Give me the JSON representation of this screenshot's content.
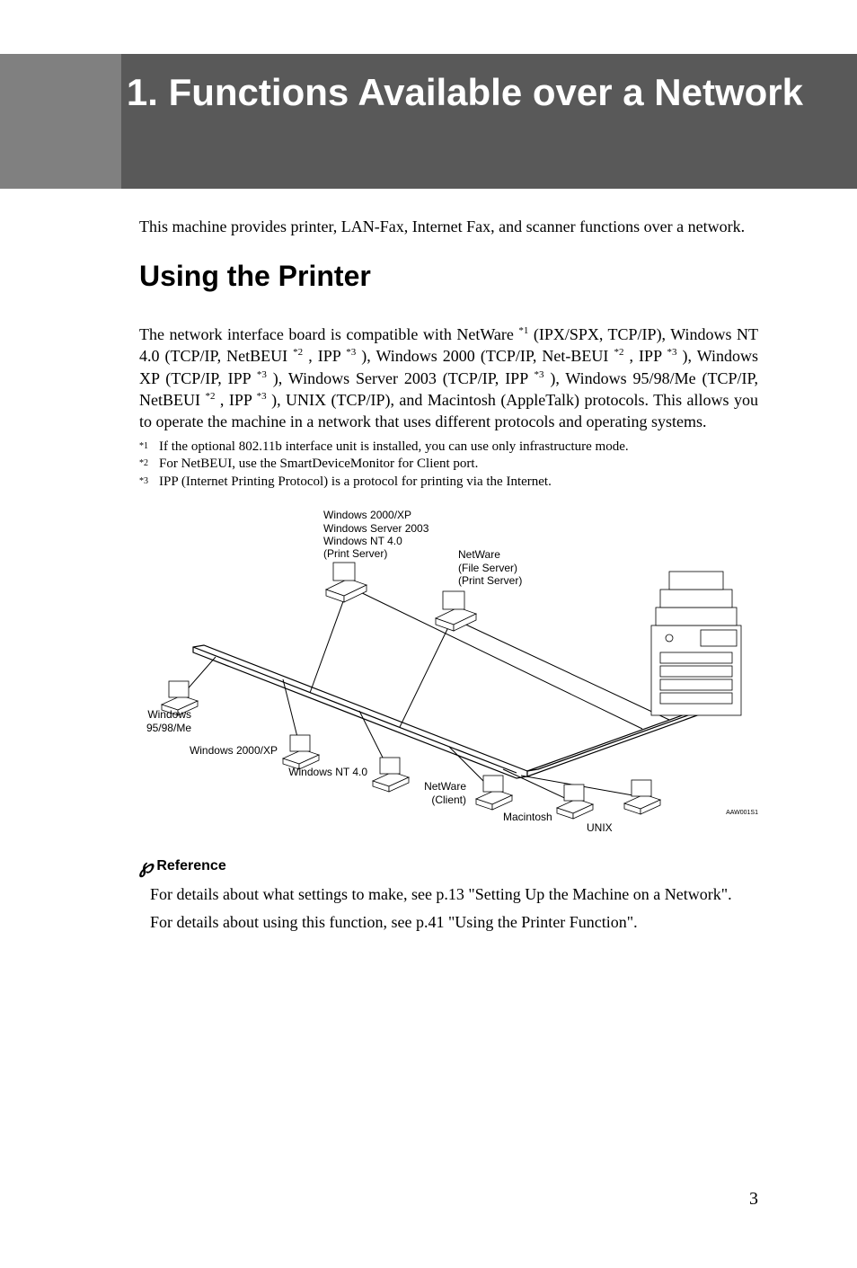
{
  "page": {
    "number": "3"
  },
  "chapter": {
    "title": "1. Functions Available over a Network"
  },
  "intro": "This machine provides printer, LAN-Fax, Internet Fax, and scanner functions over a network.",
  "section": {
    "heading": "Using the Printer",
    "body_parts": {
      "p1": "The network interface board is compatible with NetWare ",
      "sup1": "*1",
      "p2": " (IPX/SPX, TCP/IP), Windows NT 4.0 (TCP/IP, NetBEUI ",
      "sup2": "*2",
      "p3": " , IPP ",
      "sup3": "*3",
      "p4": " ), Windows 2000 (TCP/IP, Net-BEUI ",
      "sup4": "*2",
      "p5": " , IPP ",
      "sup5": "*3",
      "p6": " ), Windows XP (TCP/IP, IPP ",
      "sup6": "*3",
      "p7": " ), Windows Server 2003 (TCP/IP, IPP ",
      "sup7": "*3",
      "p8": " ), Windows 95/98/Me (TCP/IP, NetBEUI ",
      "sup8": "*2",
      "p9": " , IPP ",
      "sup9": "*3",
      "p10": " ), UNIX (TCP/IP), and Macintosh (AppleTalk) protocols. This allows you to operate the machine in a network that uses different protocols and operating systems."
    }
  },
  "footnotes": [
    {
      "num": "*1",
      "text": "If the optional 802.11b interface unit is installed, you can use only infrastructure mode."
    },
    {
      "num": "*2",
      "text": "For NetBEUI, use the SmartDeviceMonitor for Client port."
    },
    {
      "num": "*3",
      "text": "IPP (Internet Printing Protocol) is a protocol for printing via the Internet."
    }
  ],
  "diagram": {
    "labels": {
      "topserver1": "Windows 2000/XP",
      "topserver2": "Windows Server 2003",
      "topserver3": "Windows NT 4.0",
      "topserver4": "(Print Server)",
      "netware1": "NetWare",
      "netware2": "(File Server)",
      "netware3": "(Print Server)",
      "win9598": "Windows 95/98/Me",
      "win2000xp": "Windows 2000/XP",
      "winnt40": "Windows NT 4.0",
      "nwclient1": "NetWare",
      "nwclient2": "(Client)",
      "macintosh": "Macintosh",
      "unix": "UNIX"
    },
    "id": "AAW001S1"
  },
  "reference": {
    "heading": "Reference",
    "p1": "For details about what settings to make, see p.13 \"Setting Up the Machine on a Network\".",
    "p2": "For details about using this function, see p.41 \"Using the Printer Function\"."
  }
}
